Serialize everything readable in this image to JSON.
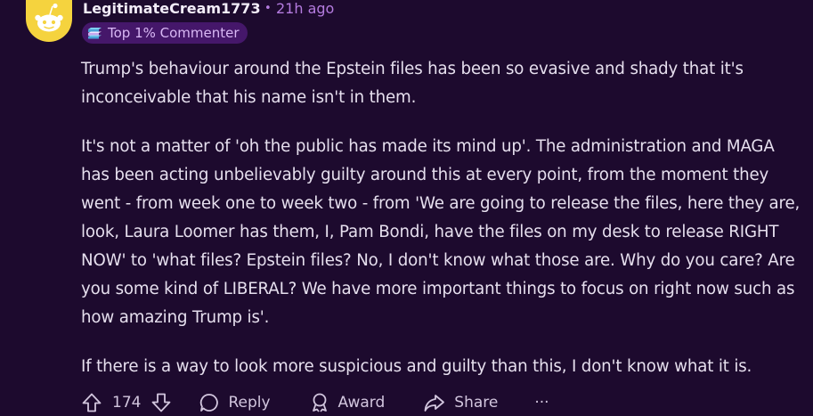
{
  "comment": {
    "username": "LegitimateCream1773",
    "separator": "•",
    "time": "21h ago",
    "flair": {
      "icon": "commenter-badge-icon",
      "label": "Top 1% Commenter"
    },
    "paragraphs": [
      "Trump's behaviour around the Epstein files has been so evasive and shady that it's inconceivable that his name isn't in them.",
      "It's not a matter of 'oh the public has made its mind up'. The administration and MAGA has been acting unbelievably guilty around this at every point, from the moment they went - from week one to week two - from 'We are going to release the files, here they are, look, Laura Loomer has them, I, Pam Bondi, have the files on my desk to release RIGHT NOW' to 'what files? Epstein files? No, I don't know what those are. Why do you care? Are you some kind of LIBERAL? We have more important things to focus on right now such as how amazing Trump is'.",
      "If there is a way to look more suspicious and guilty than this, I don't know what it is."
    ]
  },
  "actions": {
    "vote_count": "174",
    "reply_label": "Reply",
    "award_label": "Award",
    "share_label": "Share",
    "more_label": "···"
  },
  "colors": {
    "background": "#1d0a2e",
    "accent_purple": "#b57ce0",
    "flair_bg": "#45176a",
    "avatar_yellow": "#f5d33e"
  }
}
